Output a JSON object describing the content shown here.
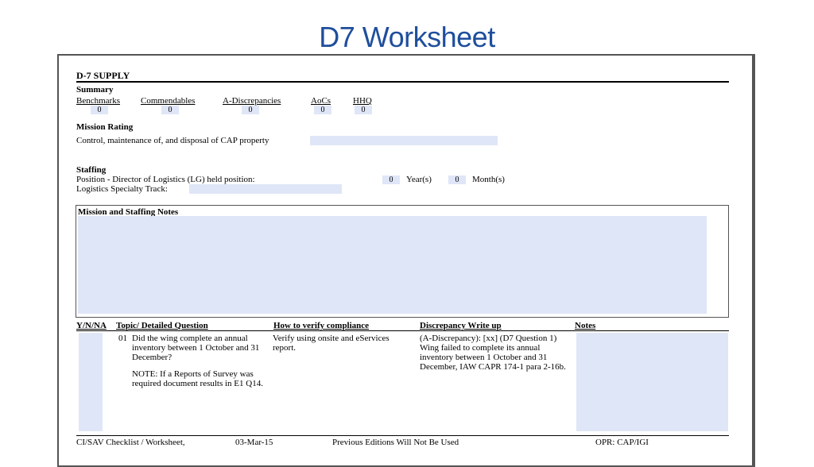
{
  "slide": {
    "title": "D7 Worksheet"
  },
  "doc": {
    "section_title": "D-7 SUPPLY",
    "summary": {
      "heading": "Summary",
      "columns": [
        {
          "label": "Benchmarks",
          "value": "0"
        },
        {
          "label": "Commendables",
          "value": "0"
        },
        {
          "label": "A-Discrepancies",
          "value": "0"
        },
        {
          "label": "AoCs",
          "value": "0"
        },
        {
          "label": "HHQ",
          "value": "0"
        }
      ]
    },
    "mission_rating": {
      "heading": "Mission Rating",
      "item": "Control, maintenance of, and disposal of CAP property"
    },
    "staffing": {
      "heading": "Staffing",
      "position_label": "Position - Director of Logistics (LG) held position:",
      "years_value": "0",
      "years_label": "Year(s)",
      "months_value": "0",
      "months_label": "Month(s)",
      "track_label": "Logistics Specialty Track:"
    },
    "notes_heading": "Mission and Staffing Notes",
    "table": {
      "headers": {
        "yn": "Y/N/NA",
        "topic": "Topic/ Detailed Question",
        "verify": "How to verify compliance",
        "write_up": "Discrepancy Write up",
        "notes": "Notes"
      },
      "row": {
        "number": "01",
        "question": "Did the wing complete an annual inventory between 1 October and 31 December?",
        "note": "NOTE:  If a Reports of Survey was required document results in E1 Q14.",
        "verify": "Verify using onsite and eServices report.",
        "write_up": "(A-Discrepancy): [xx] (D7 Question 1) Wing failed to complete its annual inventory between 1 October and 31 December, IAW CAPR 174-1 para 2-16b."
      }
    },
    "footer": {
      "form": "CI/SAV Checklist / Worksheet,",
      "date": "03-Mar-15",
      "editions": "Previous Editions Will Not Be Used",
      "opr": "OPR: CAP/IGI"
    }
  }
}
